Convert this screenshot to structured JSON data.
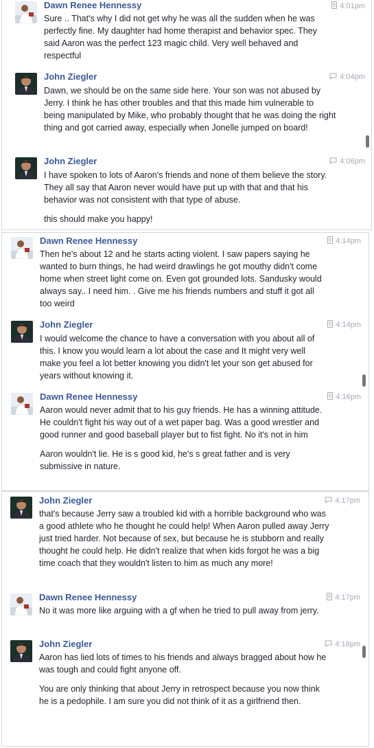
{
  "messages": [
    {
      "sender": "Dawn Renee Hennessy",
      "time": "4:01pm",
      "time_icon": "phone-icon",
      "avatar": "dawn",
      "paragraphs": [
        "Sure .. That's why I did not get why he was all the sudden when he was perfectly fine. My daughter had home therapist and behavior spec. They said Aaron was the perfect 123 magic child. Very well behaved and respectful"
      ]
    },
    {
      "sender": "John Ziegler",
      "time": "4:04pm",
      "time_icon": "chat-icon",
      "avatar": "john",
      "paragraphs": [
        "Dawn, we should be on the same side here. Your son was not abused by Jerry. I think he has other troubles and that this made him vulnerable to being manipulated by Mike, who probably thought that he was doing the right thing and got carried away, especially when Jonelle jumped on board!"
      ]
    },
    {
      "sender": "John Ziegler",
      "time": "4:06pm",
      "time_icon": "chat-icon",
      "avatar": "john",
      "paragraphs": [
        "I have spoken to lots of Aaron's friends and none of them believe the story. They all say that Aaron never would have put up with that and that his behavior was not consistent with that type of abuse.",
        "this should make you happy!"
      ]
    },
    {
      "sender": "Dawn Renee Hennessy",
      "time": "4:14pm",
      "time_icon": "phone-icon",
      "avatar": "dawn",
      "paragraphs": [
        "Then he's about 12 and he starts acting violent. I saw papers saying he wanted to burn things, he had weird drawlings he got mouthy didn't come home when street light come on. Even got grounded lots. Sandusky would always say.. I need him. . Give me his friends numbers and stuff it got all too weird"
      ]
    },
    {
      "sender": "John Ziegler",
      "time": "4:14pm",
      "time_icon": "chat-icon",
      "avatar": "john",
      "paragraphs": [
        "I would welcome the chance to have a conversation with you about all of this. I know you would learn a lot about the case and It might very well make you feel a lot better knowing you didn't let your son get abused for years without knowing it."
      ]
    },
    {
      "sender": "Dawn Renee Hennessy",
      "time": "4:16pm",
      "time_icon": "phone-icon",
      "avatar": "dawn",
      "paragraphs": [
        "Aaron would never admit that to his guy friends. He has a winning attitude. He couldn't fight his way out of a wet paper bag. Was a good wrestler and good runner and good baseball player but to fist fight. No it's not in him",
        "Aaron wouldn't lie. He is s good kid, he's s great father and is very submissive in nature."
      ]
    },
    {
      "sender": "John Ziegler",
      "time": "4:17pm",
      "time_icon": "chat-icon",
      "avatar": "john",
      "paragraphs": [
        "that's because Jerry saw a troubled kid with a horrible background who was a good athlete who he thought he could help! When Aaron pulled away Jerry just tried harder. Not because of sex, but because he is stubborn and really thought he could help. He didn't realize that when kids forgot he was a big time coach that they wouldn't listen to him as much any more!"
      ]
    },
    {
      "sender": "Dawn Renee Hennessy",
      "time": "4:17pm",
      "time_icon": "phone-icon",
      "avatar": "dawn",
      "paragraphs": [
        "No it was more like arguing with a gf when he tried to pull away from jerry."
      ]
    },
    {
      "sender": "John Ziegler",
      "time": "4:18pm",
      "time_icon": "chat-icon",
      "avatar": "john",
      "paragraphs": [
        "Aaron has lied lots of times to his friends and always bragged about how he was tough and could fight anyone off.",
        "You are only thinking that about Jerry in retrospect because you now think he is a pedophile. I am sure you did not think of it as a girlfriend then."
      ]
    }
  ]
}
